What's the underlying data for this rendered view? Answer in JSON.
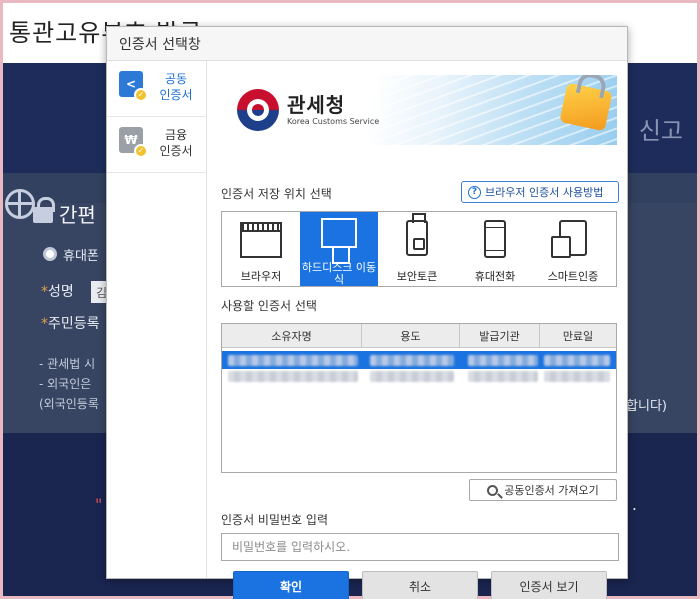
{
  "background": {
    "title": "통관고유부호 발급",
    "header_right": "신고",
    "section_title": "간편",
    "radio_label": "휴대폰",
    "fields": [
      {
        "star": "*",
        "label": "성명"
      },
      {
        "star": "*",
        "label": "주민등록"
      }
    ],
    "name_value": "김",
    "notes": [
      "- 관세법 시",
      "- 외국인은",
      "(외국인등록"
    ],
    "right_note": "합니다)",
    "bottom_red": "\"",
    "bottom_dot": "."
  },
  "dialog": {
    "title": "인증서 선택창",
    "sidebar": [
      {
        "line1": "공동",
        "line2": "인증서",
        "icon_text": "<",
        "icon": "share-icon",
        "active": true
      },
      {
        "line1": "금융",
        "line2": "인증서",
        "icon_text": "₩",
        "icon": "won-icon",
        "active": false
      }
    ],
    "banner": {
      "name_ko": "관세청",
      "name_en": "Korea Customs Service"
    },
    "storage_section_label": "인증서 저장 위치 선택",
    "help_button": "브라우저 인증서 사용방법",
    "storage_options": [
      {
        "label": "브라우저",
        "icon": "browser-window-icon"
      },
      {
        "label": "하드디스크 이동식",
        "icon": "usb-drive-icon",
        "selected": true
      },
      {
        "label": "보안토큰",
        "icon": "security-token-icon"
      },
      {
        "label": "휴대전화",
        "icon": "mobile-phone-icon"
      },
      {
        "label": "스마트인증",
        "icon": "smart-card-icon"
      }
    ],
    "cert_section_label": "사용할 인증서 선택",
    "table_headers": [
      "소유자명",
      "용도",
      "발급기관",
      "만료일"
    ],
    "import_button": "공동인증서 가져오기",
    "password_label": "인증서 비밀번호 입력",
    "password_placeholder": "비밀번호를 입력하시오.",
    "buttons": {
      "confirm": "확인",
      "cancel": "취소",
      "view": "인증서 보기"
    },
    "colors": {
      "accent": "#1a73e0",
      "brand_red": "#c8102e",
      "brand_blue": "#1e3f8a"
    }
  }
}
